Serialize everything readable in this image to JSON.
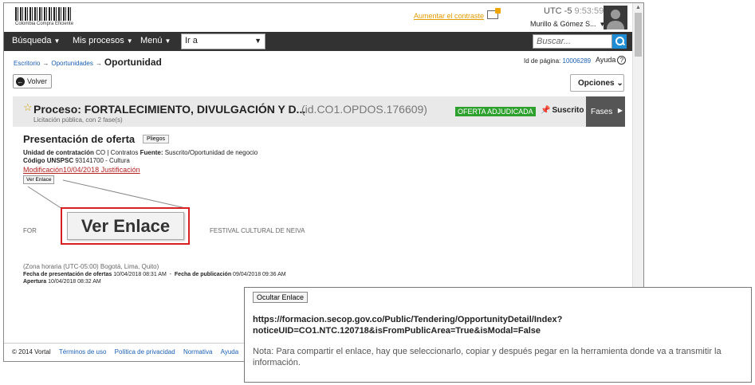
{
  "header": {
    "logo_text": "Colombia Compra Eficiente",
    "contrast_link": "Aumentar el contraste",
    "timezone": "UTC -5",
    "clock": "9:53:59",
    "user_name": "Murillo & Gómez S..."
  },
  "nav": {
    "items": [
      "Búsqueda",
      "Mis procesos",
      "Menú"
    ],
    "goto_value": "Ir a",
    "search_placeholder": "Buscar..."
  },
  "breadcrumb": {
    "items": [
      "Escritorio",
      "Oportunidades"
    ],
    "current": "Oportunidad",
    "separator": "→"
  },
  "page_id": {
    "label": "Id de página:",
    "value": "10006289"
  },
  "help_label": "Ayuda",
  "buttons": {
    "back": "Volver",
    "options": "Opciones"
  },
  "process": {
    "title": "Proceso: FORTALECIMIENTO, DIVULGACIÓN Y D...",
    "id": "(id.CO1.OPDOS.176609)",
    "subtitle": "Licitación pública, con 2 fase(s)",
    "status": "OFERTA ADJUDICADA",
    "subscribed": "Suscrito",
    "phases": "Fases"
  },
  "section": {
    "title": "Presentación de oferta",
    "pliegos": "Pliegos",
    "unit_label": "Unidad de contratación",
    "unit_value": "CO | Contratos",
    "source_label": "Fuente:",
    "source_value": "Suscrito/Oportunidad de negocio",
    "unspsc_label": "Código UNSPSC",
    "unspsc_value": "93141700 - Cultura",
    "modification": "Modificación",
    "modification_date": "10/04/2018",
    "justification": "Justificación",
    "ver_enlace": "Ver Enlace",
    "ver_enlace_zoom": "Ver Enlace",
    "for_text": "FOR",
    "festival_text": "FESTIVAL CULTURAL DE NEIVA",
    "zone": "(Zona horaria (UTC-05:00) Bogotá, Lima, Quito)",
    "offers_label": "Fecha de presentación de ofertas",
    "offers_value": "10/04/2018 08:31 AM",
    "dash": "-",
    "publication_label": "Fecha de publicación",
    "publication_value": "09/04/2018 09:36 AM",
    "opening_label": "Apertura",
    "opening_value": "10/04/2018 08:32 AM"
  },
  "footer": {
    "copyright": "© 2014 Vortal",
    "links": [
      "Términos de uso",
      "Política de privacidad",
      "Normativa",
      "Ayuda"
    ]
  },
  "popup": {
    "hide_button": "Ocultar Enlace",
    "url_line1": "https://formacion.secop.gov.co/Public/Tendering/OpportunityDetail/Index?",
    "url_line2": "noticeUID=CO1.NTC.120718&isFromPublicArea=True&isModal=False",
    "note": "Nota: Para compartir el enlace, hay que seleccionarlo, copiar y después pegar en la herramienta donde va a transmitir la información."
  },
  "colors": {
    "navbar": "#323232",
    "status_green": "#2ea02e",
    "highlight_red": "#d92020",
    "link_blue": "#1a5fb4",
    "contrast_orange": "#e39a00"
  }
}
